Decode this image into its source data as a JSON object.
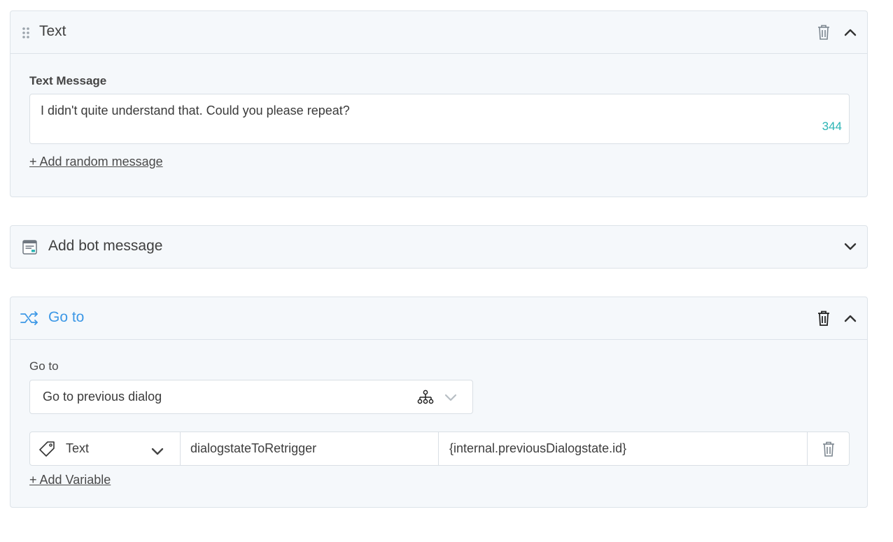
{
  "text_card": {
    "title": "Text",
    "field_label": "Text Message",
    "message_value": "I didn't quite understand that. Could you please repeat?",
    "char_count": "344",
    "add_random_label": "+ Add random message"
  },
  "bot_message_card": {
    "title": "Add bot message"
  },
  "goto_card": {
    "title": "Go to",
    "field_label": "Go to",
    "select_value": "Go to previous dialog",
    "variable_row": {
      "type_label": "Text",
      "name_value": "dialogstateToRetrigger",
      "value_value": "{internal.previousDialogstate.id}"
    },
    "add_variable_label": "+ Add Variable"
  },
  "colors": {
    "accent_blue": "#3d98e6",
    "counter_teal": "#2cb5b5",
    "card_bg": "#f5f8fb",
    "border": "#dde3e9"
  }
}
